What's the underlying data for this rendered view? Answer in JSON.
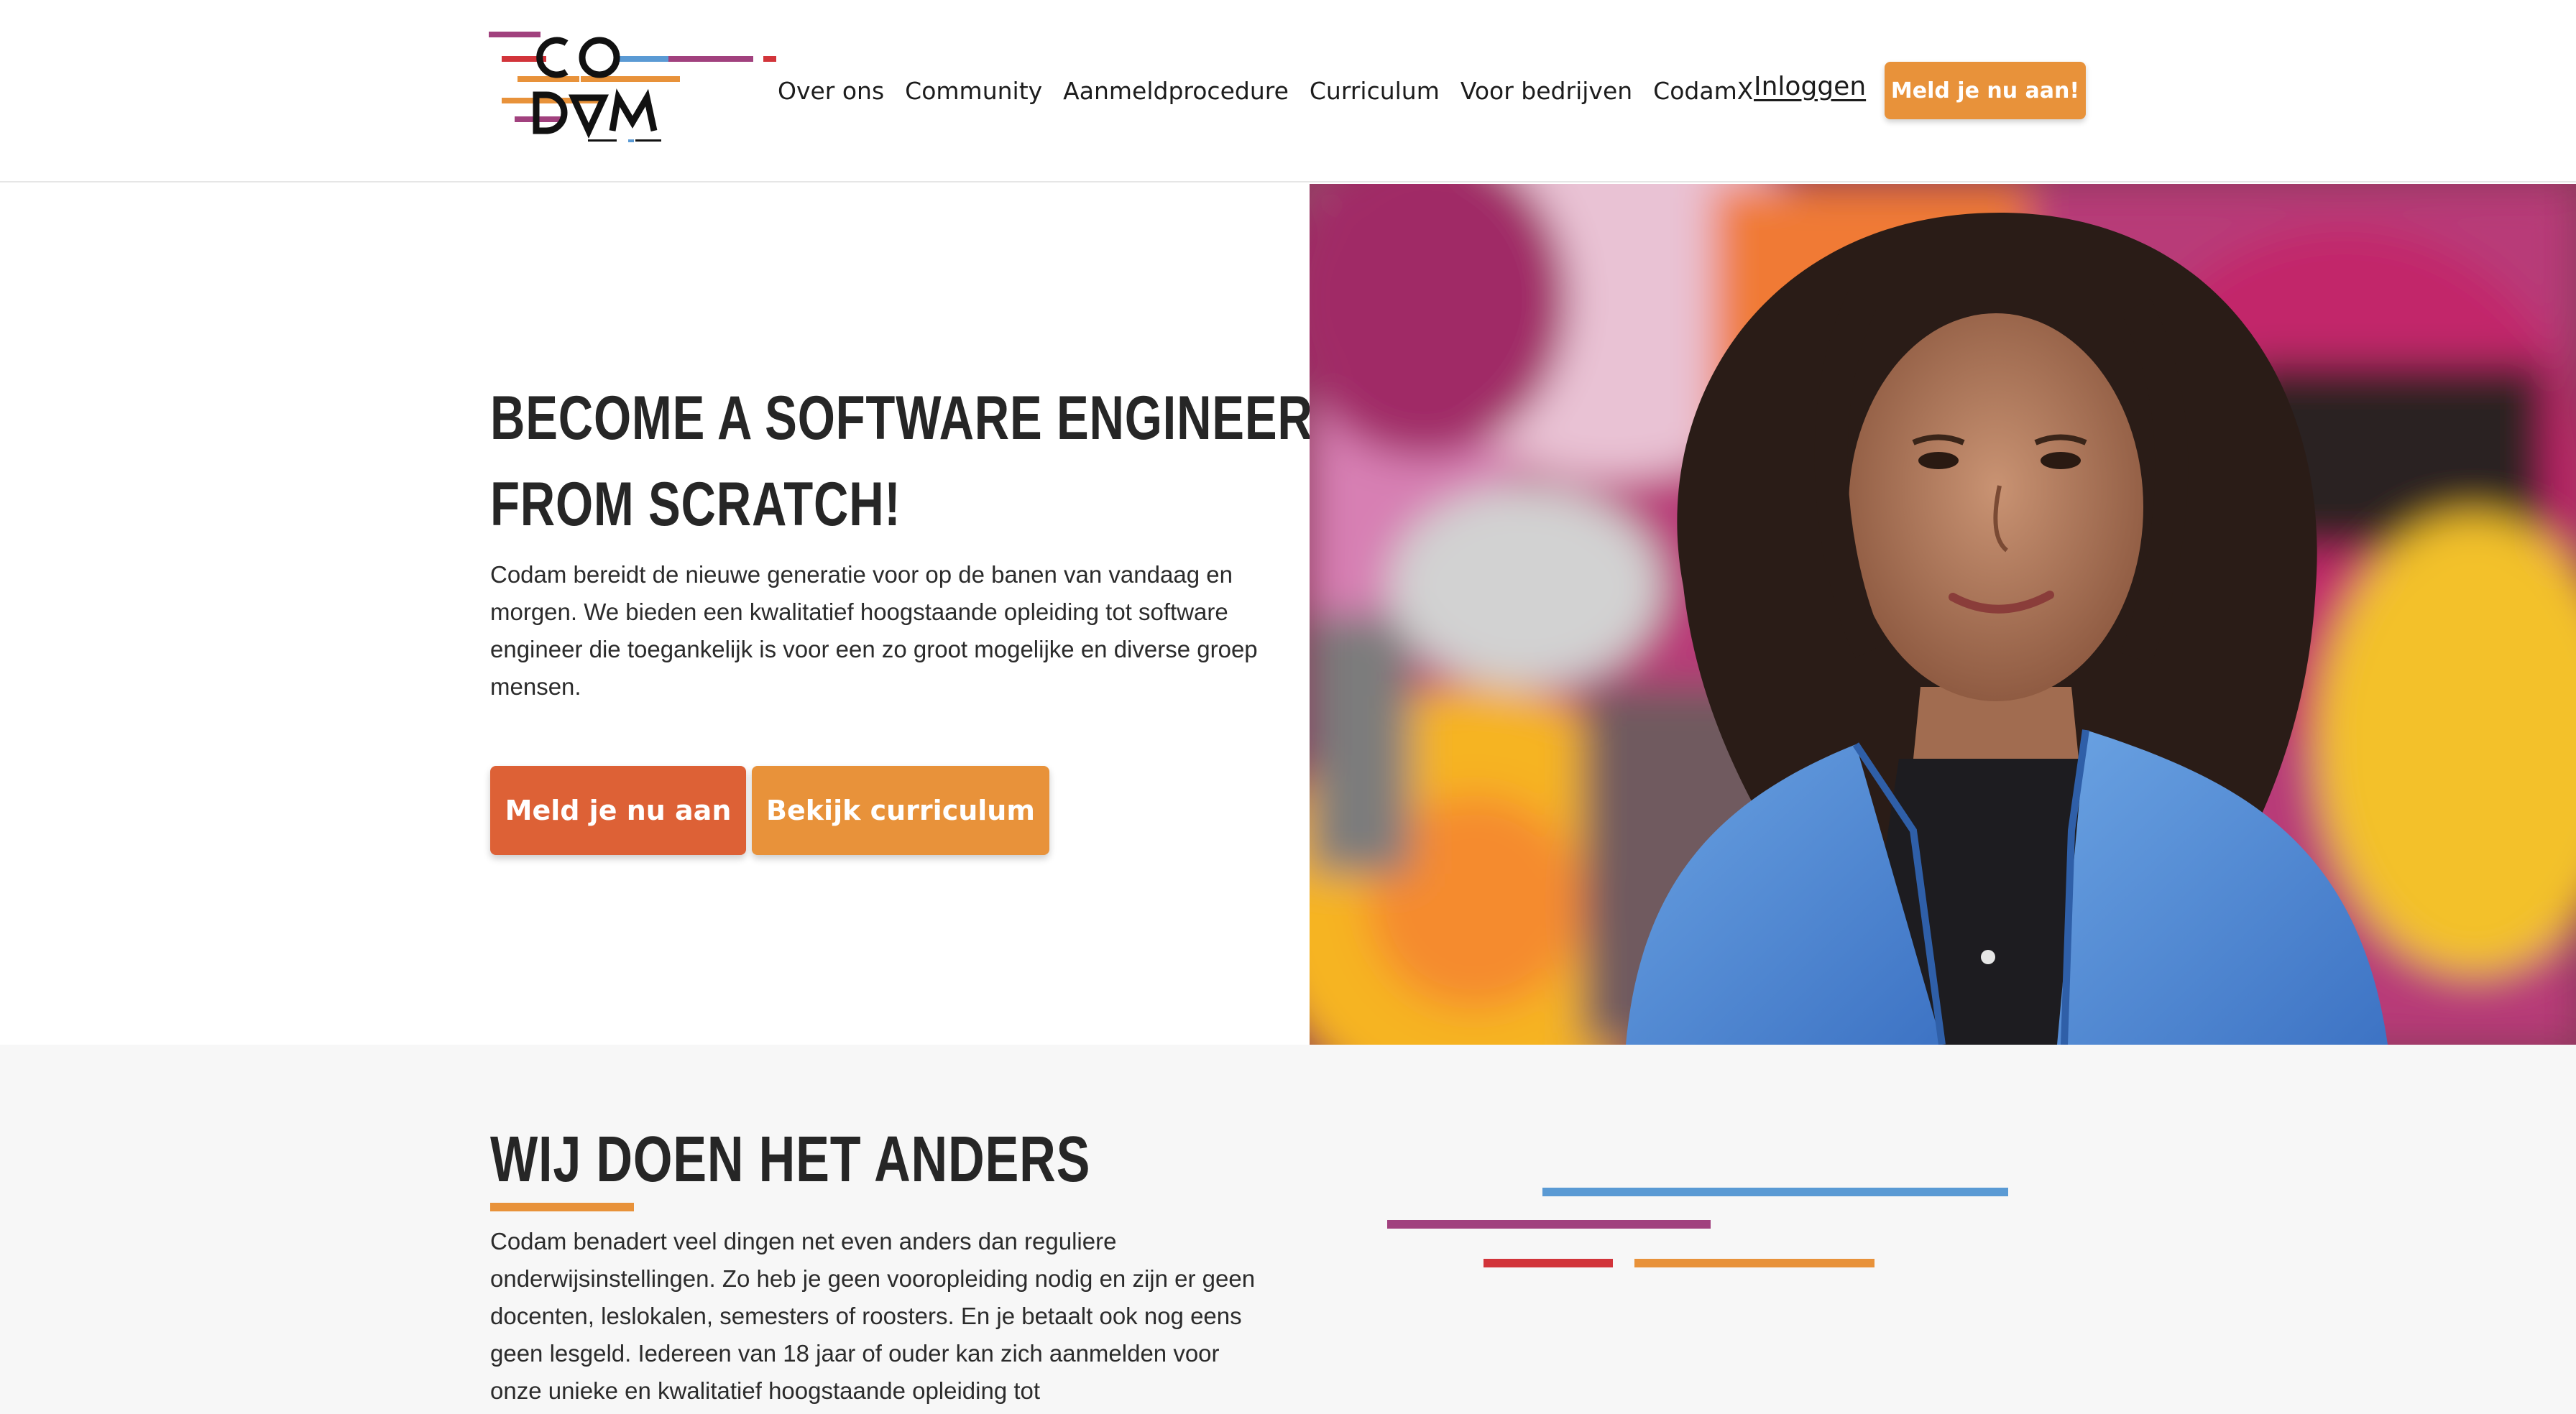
{
  "brand": {
    "name": "CODAM",
    "accent_orange": "#e8923a",
    "accent_red_orange": "#dd6136",
    "accent_magenta": "#a1417e",
    "accent_blue": "#5a9ad4",
    "accent_red": "#d2343a"
  },
  "header": {
    "nav": [
      "Over ons",
      "Community",
      "Aanmeldprocedure",
      "Curriculum",
      "Voor bedrijven",
      "CodamX"
    ],
    "login_label": "Inloggen",
    "cta_label": "Meld je nu aan!"
  },
  "hero": {
    "title_line1": "BECOME A SOFTWARE ENGINEER",
    "title_line2": "FROM SCRATCH!",
    "text": "Codam bereidt de nieuwe generatie voor op de banen van vandaag en morgen. We bieden een kwalitatief hoogstaande opleiding tot software engineer die toegankelijk is voor een zo groot mogelijke en diverse groep mensen.",
    "primary_button": "Meld je nu aan",
    "secondary_button": "Bekijk curriculum"
  },
  "section2": {
    "title": "WIJ DOEN HET ANDERS",
    "text": "Codam benadert veel dingen net even anders dan reguliere onderwijsinstellingen. Zo heb je geen vooropleiding nodig en zijn er geen docenten, leslokalen, semesters of roosters. En je betaalt ook nog eens geen lesgeld. Iedereen van 18 jaar of ouder kan zich aanmelden voor onze unieke en kwalitatief hoogstaande opleiding tot"
  }
}
